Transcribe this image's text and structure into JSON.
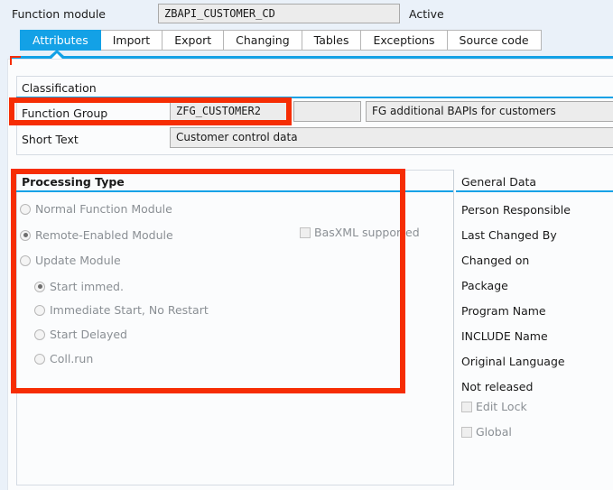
{
  "header": {
    "label": "Function module",
    "value": "ZBAPI_CUSTOMER_CD",
    "status": "Active"
  },
  "tabs": [
    {
      "label": "Attributes",
      "active": true
    },
    {
      "label": "Import",
      "active": false
    },
    {
      "label": "Export",
      "active": false
    },
    {
      "label": "Changing",
      "active": false
    },
    {
      "label": "Tables",
      "active": false
    },
    {
      "label": "Exceptions",
      "active": false
    },
    {
      "label": "Source code",
      "active": false
    }
  ],
  "classification": {
    "title": "Classification",
    "function_group": {
      "label": "Function Group",
      "value": "ZFG_CUSTOMER2",
      "extra_value": "",
      "description": "FG additional BAPIs for customers"
    },
    "short_text": {
      "label": "Short Text",
      "value": "Customer control data"
    }
  },
  "processing_type": {
    "title": "Processing Type",
    "options": [
      {
        "label": "Normal Function Module",
        "checked": false,
        "indent": false
      },
      {
        "label": "Remote-Enabled Module",
        "checked": true,
        "indent": false
      },
      {
        "label": "Update Module",
        "checked": false,
        "indent": false
      },
      {
        "label": "Start immed.",
        "checked": true,
        "indent": true
      },
      {
        "label": "Immediate Start, No Restart",
        "checked": false,
        "indent": true
      },
      {
        "label": "Start Delayed",
        "checked": false,
        "indent": true
      },
      {
        "label": "Coll.run",
        "checked": false,
        "indent": true
      }
    ],
    "basxml": {
      "label": "BasXML supported",
      "checked": false
    }
  },
  "general_data": {
    "title": "General Data",
    "items": [
      "Person Responsible",
      "Last Changed By",
      "Changed on",
      "Package",
      "Program Name",
      "INCLUDE Name",
      "Original Language",
      "Not released"
    ],
    "checkboxes": [
      {
        "label": "Edit Lock",
        "checked": false
      },
      {
        "label": "Global",
        "checked": false
      }
    ]
  },
  "colors": {
    "accent_blue": "#13a1e6",
    "annotation_red": "#f62d04",
    "header_bg": "#eaf1f9",
    "content_bg": "#fbfcfd"
  }
}
